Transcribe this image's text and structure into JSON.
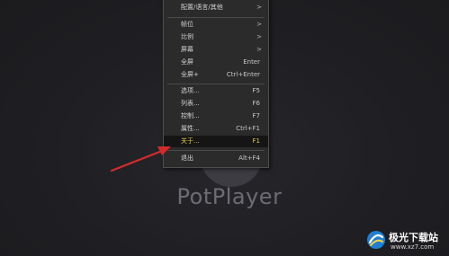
{
  "app": {
    "name": "PotPlayer"
  },
  "menu": {
    "items": [
      {
        "label": "配置/语言/其他",
        "shortcut": "",
        "submenu": true
      },
      {
        "label": "帧位",
        "shortcut": "",
        "submenu": true
      },
      {
        "label": "比例",
        "shortcut": "",
        "submenu": true
      },
      {
        "label": "屏幕",
        "shortcut": "",
        "submenu": true
      },
      {
        "label": "全屏",
        "shortcut": "Enter",
        "submenu": false
      },
      {
        "label": "全屏+",
        "shortcut": "Ctrl+Enter",
        "submenu": false
      },
      {
        "label": "选项...",
        "shortcut": "F5",
        "submenu": false
      },
      {
        "label": "列表...",
        "shortcut": "F6",
        "submenu": false
      },
      {
        "label": "控制...",
        "shortcut": "F7",
        "submenu": false
      },
      {
        "label": "属性...",
        "shortcut": "Ctrl+F1",
        "submenu": false
      },
      {
        "label": "关于...",
        "shortcut": "F1",
        "submenu": false,
        "highlighted": true
      },
      {
        "label": "退出",
        "shortcut": "Alt+F4",
        "submenu": false
      }
    ],
    "submenu_arrow": ">"
  },
  "watermark": {
    "title": "极光下载站",
    "url": "www.xz7.com"
  },
  "colors": {
    "background": "#1e1e22",
    "menu_bg": "#2b2b2b",
    "highlight_text": "#e8c84a",
    "arrow": "#d42a2a"
  },
  "icons": {
    "annotation": "red-arrow-icon",
    "watermark_logo": "aurora-logo-icon"
  }
}
